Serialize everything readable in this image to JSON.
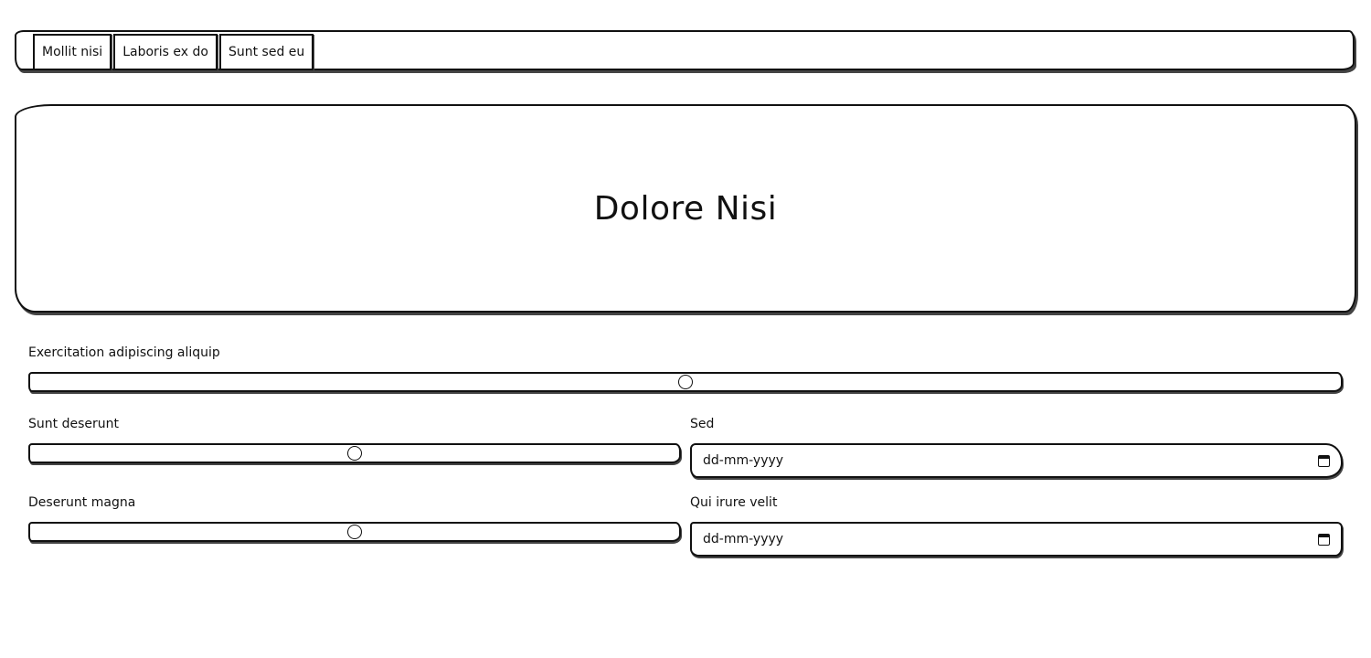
{
  "navbar": {
    "tabs": [
      "Mollit nisi",
      "Laboris ex do",
      "Sunt sed eu"
    ]
  },
  "hero": {
    "title": "Dolore Nisi"
  },
  "form": {
    "slider_main": {
      "label": "Exercitation adipiscing aliquip",
      "value": 0.5
    },
    "slider_left_1": {
      "label": "Sunt deserunt",
      "value": 0.5
    },
    "slider_left_2": {
      "label": "Deserunt magna",
      "value": 0.5
    },
    "date_1": {
      "label": "Sed",
      "placeholder": "dd-mm-yyyy"
    },
    "date_2": {
      "label": "Qui irure velit",
      "placeholder": "dd-mm-yyyy"
    }
  },
  "icons": {
    "date_picker": "calendar-icon"
  }
}
